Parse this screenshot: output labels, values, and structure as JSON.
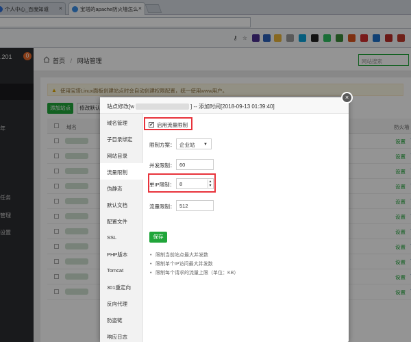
{
  "browser": {
    "tabs": [
      {
        "title": "个人中心_百度知道",
        "favicon_color": "#2f6fd6"
      },
      {
        "title": "宝塔的apache防火墙怎么",
        "favicon_color": "#3a8ee6"
      }
    ],
    "close_glyph": "×"
  },
  "sidebar": {
    "ip_fragment": ".201",
    "badge": "0",
    "items": [
      {
        "label": "年"
      },
      {
        "label": "任务"
      },
      {
        "label": "管理"
      },
      {
        "label": "设置"
      }
    ]
  },
  "header": {
    "breadcrumb": [
      "首页",
      "/",
      "网站管理"
    ],
    "search_placeholder": "网站搜索"
  },
  "alert": {
    "text": "使用宝塔Linux面板创建站点时会自动创建权限配置，统一使用www用户。"
  },
  "toolbar": {
    "add_site_label": "添加站点",
    "default_page_label": "修改默认页"
  },
  "table": {
    "headers": [
      "域名",
      "防火墙"
    ],
    "row_action": "设置",
    "row_count": 11
  },
  "modal": {
    "title_prefix": "站点修改[w",
    "title_suffix": "] -- 添加时间[2018-09-13 01:39:40]",
    "nav": [
      "域名管理",
      "子目录绑定",
      "网站目录",
      "流量限制",
      "伪静态",
      "默认文档",
      "配置文件",
      "SSL",
      "PHP版本",
      "Tomcat",
      "301重定向",
      "反向代理",
      "防盗链",
      "响应日志"
    ],
    "active_nav_index": 3,
    "enable_label": "启用流量限制",
    "enable_checked": true,
    "scheme_label": "限制方案：",
    "scheme_value": "企业站",
    "concurrency_label": "并发限制：",
    "concurrency_value": "60",
    "per_ip_label": "单IP限制：",
    "per_ip_value": "8",
    "rate_label": "流量限制：",
    "rate_value": "512",
    "save_label": "保存",
    "notes": [
      "限制当前站点最大并发数",
      "限制单个IP访问最大并发数",
      "限制每个请求的流量上限（单位：KB）"
    ]
  },
  "colors": {
    "accent_green": "#20a53a",
    "highlight_red": "#e8323a",
    "sidebar_bg": "#2c2d31"
  }
}
